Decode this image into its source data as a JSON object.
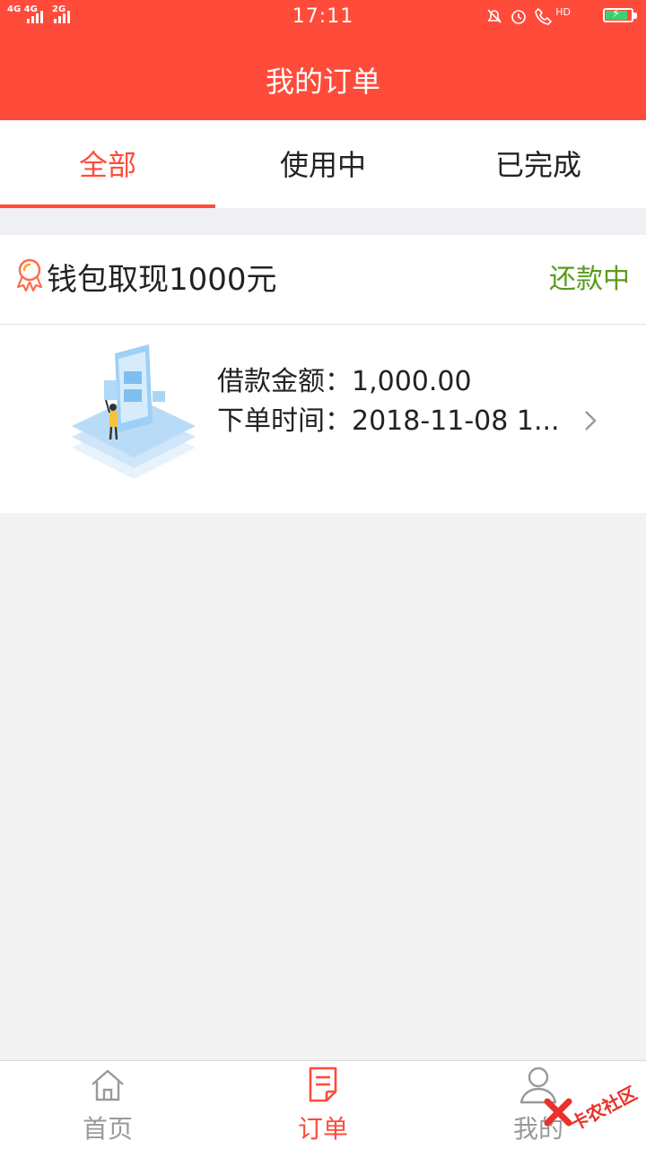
{
  "status_bar": {
    "signal1": "4G 4G",
    "signal2": "2G",
    "time": "17:11",
    "hd": "HD"
  },
  "header": {
    "title": "我的订单"
  },
  "tabs": [
    {
      "label": "全部",
      "active": true
    },
    {
      "label": "使用中",
      "active": false
    },
    {
      "label": "已完成",
      "active": false
    }
  ],
  "order": {
    "title": "钱包取现1000元",
    "status": "还款中",
    "amount_label": "借款金额：",
    "amount_value": "1,000.00",
    "time_label": "下单时间：",
    "time_value": "2018-11-08 1..."
  },
  "tabbar": {
    "items": [
      {
        "label": "首页",
        "icon": "home-icon"
      },
      {
        "label": "订单",
        "icon": "order-icon"
      },
      {
        "label": "我的",
        "icon": "profile-icon"
      }
    ]
  },
  "watermark": {
    "text": "卡农社区"
  },
  "colors": {
    "accent": "#ff4b3a",
    "status_green": "#5a9a1e",
    "inactive_gray": "#999999",
    "battery_green": "#3cd070"
  }
}
